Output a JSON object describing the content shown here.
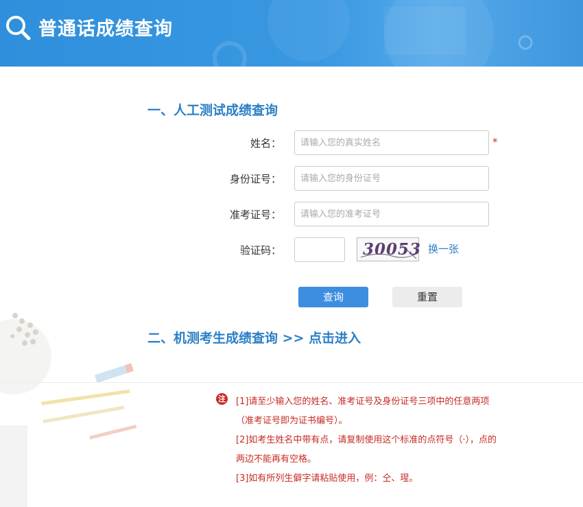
{
  "header": {
    "title": "普通话成绩查询",
    "icon": "search-icon"
  },
  "section1": {
    "title": "一、人工测试成绩查询",
    "fields": {
      "name": {
        "label": "姓名：",
        "placeholder": "请输入您的真实姓名",
        "required_mark": "*"
      },
      "id_number": {
        "label": "身份证号：",
        "placeholder": "请输入您的身份证号"
      },
      "exam_number": {
        "label": "准考证号：",
        "placeholder": "请输入您的准考证号"
      },
      "captcha": {
        "label": "验证码：",
        "placeholder": "",
        "image_text": "30053",
        "refresh_label": "换一张"
      }
    },
    "buttons": {
      "query": "查询",
      "reset": "重置"
    }
  },
  "section2": {
    "title": "二、机测考生成绩查询 >> 点击进入"
  },
  "notes": {
    "badge": "注",
    "lines": [
      "[1]请至少输入您的姓名、准考证号及身份证号三项中的任意两项",
      "（准考证号即为证书编号）。",
      "[2]如考生姓名中带有点，请复制使用这个标准的点符号（·），点的",
      "两边不能再有空格。",
      "[3]如有所列生僻字请粘贴使用，例：仝、瑆。"
    ]
  },
  "colors": {
    "header_bg": "#3a98e2",
    "accent": "#2c7fc6",
    "primary_button": "#3d8de0",
    "note_text": "#c72a22"
  }
}
